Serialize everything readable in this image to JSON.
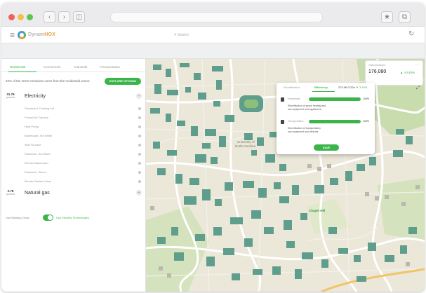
{
  "app": {
    "brand_prefix": "Dynam",
    "brand_suffix": "HOX",
    "search_placeholder": "Search"
  },
  "colors": {
    "accent": "#3bb54a",
    "map_building": "#5f9e8c",
    "map_land": "#ebe7d9",
    "map_green": "#c9dcae"
  },
  "panel": {
    "tabs": [
      "Residential",
      "Commercial",
      "Industrial",
      "Transportation"
    ],
    "active_tab": "Residential",
    "note": "34% of the GHG emissions come from the residential sector.",
    "explore_button": "EXPLORE OPTIONS",
    "categories": [
      {
        "percent": "31.76",
        "unit": "percent",
        "title": "Electricity",
        "toggle": "−",
        "items": [
          "Stovetop & Cooking Ind",
          "Forced Air Furnace",
          "Heat Pump",
          "Baseboard, Hot Water",
          "Wall Furnace",
          "Radiators, Hot Water",
          "Electric Baseboard",
          "Radiators, Steam",
          "Electric Radiant Heat"
        ]
      },
      {
        "percent": "2.78",
        "unit": "percent",
        "title": "Natural gas",
        "toggle": "+",
        "items": []
      }
    ],
    "toggle_left": "Use Building Class",
    "toggle_right": "Use Electrify Technologies"
  },
  "stats": {
    "label": "Total emissions",
    "value": "176,080",
    "change": "▲ +0.45%",
    "more_icon": "..."
  },
  "popup": {
    "tabs": [
      "Electrification",
      "Efficiency"
    ],
    "active_tab": "Efficiency",
    "co2_label": "273.06 CO2e",
    "co2_change": "▼ 3.43%",
    "rows": [
      {
        "label": "Residential",
        "percent_value": 100,
        "percent_text": "100%",
        "desc1": "Electrification of space heating and",
        "desc2": "use equipment and appliances."
      },
      {
        "label": "Transportation",
        "percent_value": 100,
        "percent_text": "100%",
        "desc1": "Electrification of transportation",
        "desc2": "use equipment and vehicles."
      }
    ],
    "save_button": "SAVE"
  },
  "map": {
    "labels": [
      {
        "text": "University of",
        "cls": ""
      },
      {
        "text": "North Carolina",
        "cls": ""
      },
      {
        "text": "Chapel Hill",
        "cls": "green"
      }
    ]
  }
}
